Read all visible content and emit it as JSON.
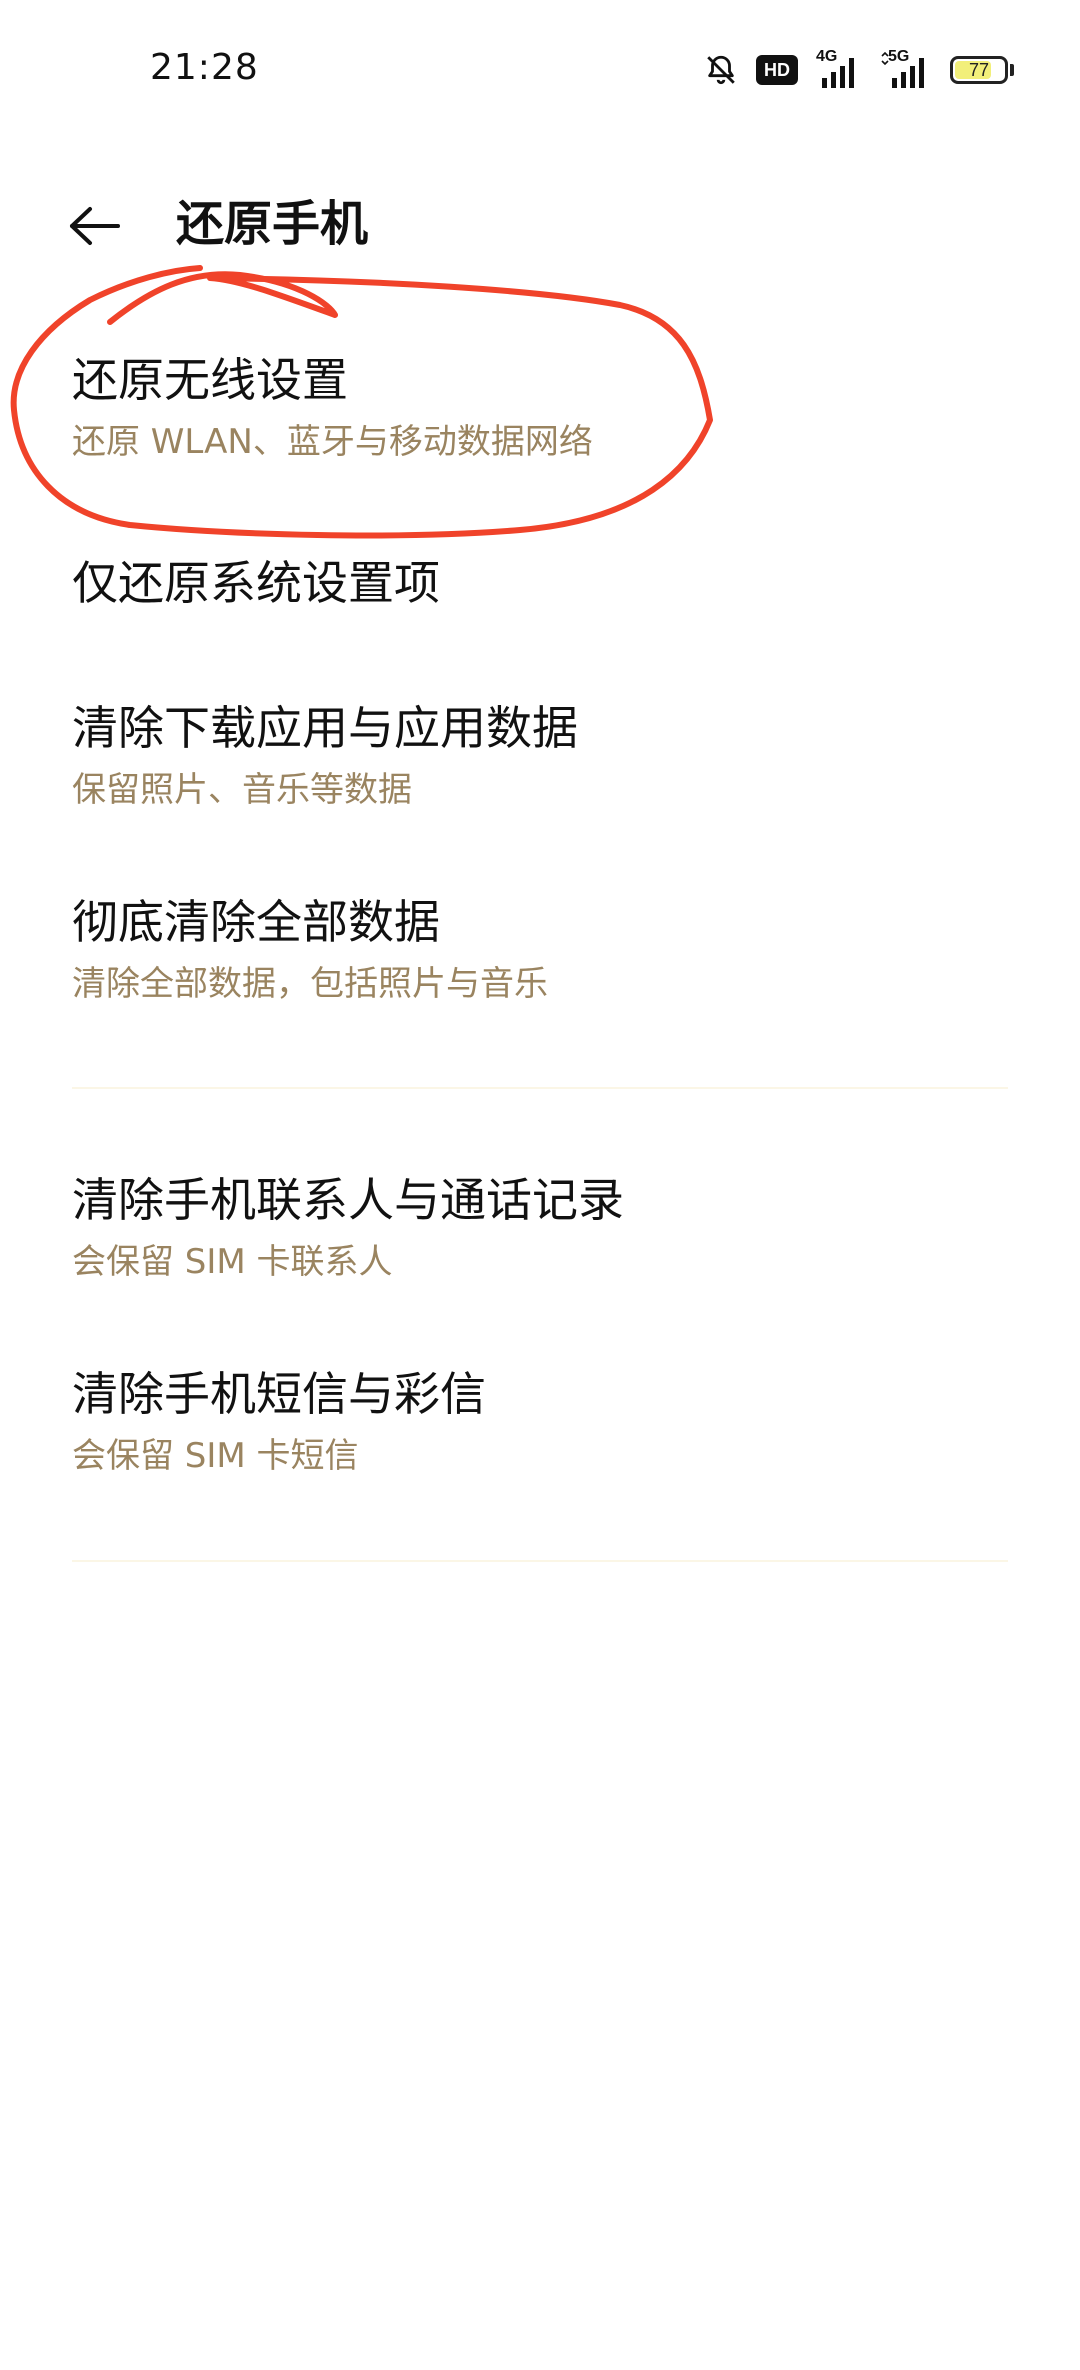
{
  "status_bar": {
    "time": "21:28",
    "hd_label": "HD",
    "network_1": "4G",
    "network_2": "5G",
    "battery_level": "77",
    "battery_fraction": 0.77,
    "icons": [
      "bell-off-icon",
      "hd-icon",
      "signal-4g-icon",
      "signal-5g-icon",
      "battery-icon"
    ]
  },
  "header": {
    "title": "还原手机",
    "back_icon": "arrow-left-icon"
  },
  "items": [
    {
      "title": "还原无线设置",
      "subtitle": "还原 WLAN、蓝牙与移动数据网络"
    },
    {
      "title": "仅还原系统设置项",
      "subtitle": ""
    },
    {
      "title": "清除下载应用与应用数据",
      "subtitle": "保留照片、音乐等数据"
    },
    {
      "title": "彻底清除全部数据",
      "subtitle": "清除全部数据，包括照片与音乐"
    },
    {
      "title": "清除手机联系人与通话记录",
      "subtitle": "会保留 SIM 卡联系人"
    },
    {
      "title": "清除手机短信与彩信",
      "subtitle": "会保留 SIM 卡短信"
    }
  ],
  "colors": {
    "subtitle": "#9a8460",
    "annotation": "#f0432a",
    "battery_fill": "#f2ef7a"
  }
}
